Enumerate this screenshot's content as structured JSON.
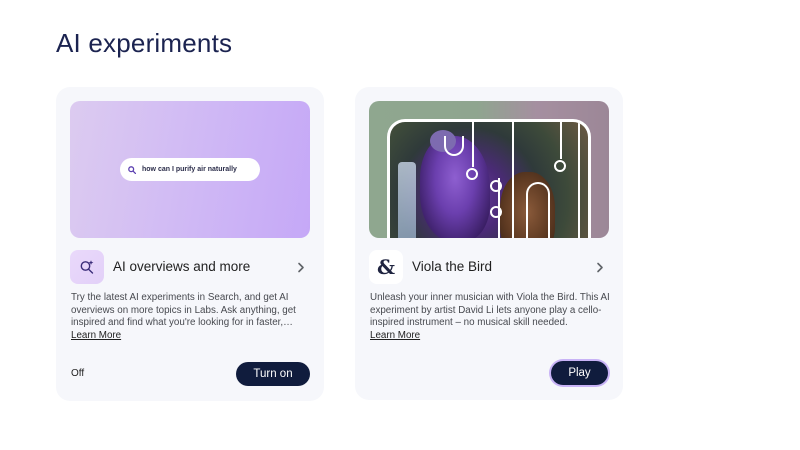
{
  "page": {
    "title": "AI experiments"
  },
  "cards": [
    {
      "title": "AI overviews and more",
      "search_query": "how can I purify air naturally",
      "description": "Try the latest AI experiments in Search, and get AI overviews on more topics in Labs. Ask anything, get inspired and find what you're looking for in faster, easier ways.",
      "learn_more": "Learn More",
      "status": "Off",
      "button_label": "Turn on",
      "icon": "sparkle-search-icon",
      "chevron_icon": "chevron-right-icon"
    },
    {
      "title": "Viola the Bird",
      "description": "Unleash your inner musician with Viola the Bird. This AI experiment by artist David Li lets anyone play a cello-inspired instrument – no musical skill needed.",
      "learn_more": "Learn More",
      "button_label": "Play",
      "icon_glyph": "&",
      "icon": "ampersand-icon",
      "chevron_icon": "chevron-right-icon"
    }
  ],
  "colors": {
    "title": "#1b2350",
    "button_bg": "#101c3d",
    "card_bg": "#f6f7fb",
    "hero_purple": "#cfb8f5",
    "play_ring": "#c8b3f6"
  }
}
